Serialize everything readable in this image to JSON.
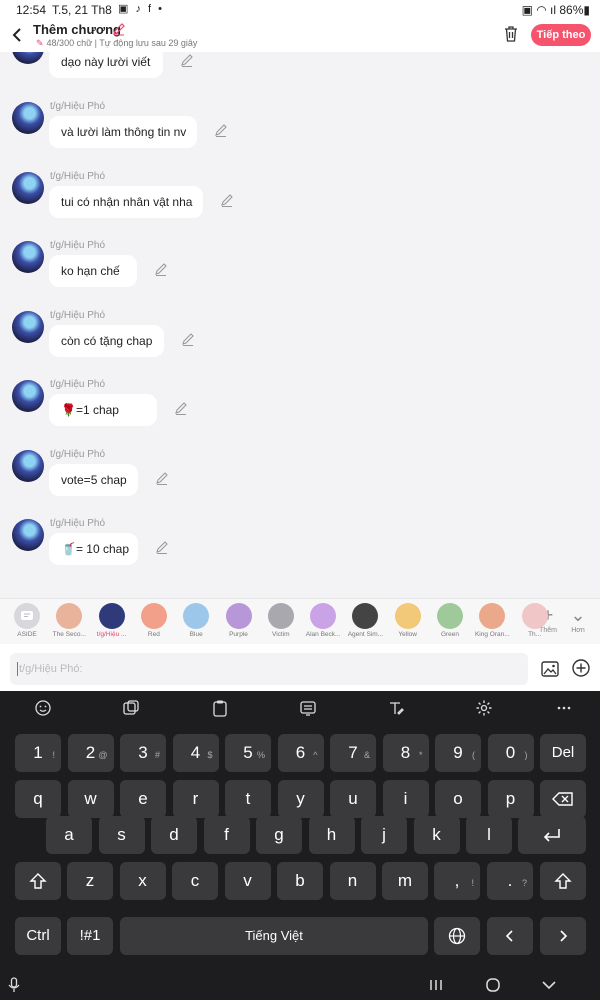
{
  "status_bar": {
    "time": "12:54",
    "date": "T.5, 21 Th8",
    "icons": "▣ ♪ f •",
    "right": "▣ ◠ ıl 86%▮"
  },
  "header": {
    "title": "Thêm chương",
    "subtitle": "48/300 chữ | Tự động lưu sau 29 giây",
    "next_label": "Tiếp theo"
  },
  "messages": [
    {
      "author": "",
      "text": "dạo này lười viết"
    },
    {
      "author": "t/g/Hiệu Phó",
      "text": "và lười làm thông tin nv"
    },
    {
      "author": "t/g/Hiệu Phó",
      "text": "tui có nhận nhân vật nha"
    },
    {
      "author": "t/g/Hiệu Phó",
      "text": "ko hạn chế"
    },
    {
      "author": "t/g/Hiệu Phó",
      "text": "còn có tặng chap"
    },
    {
      "author": "t/g/Hiệu Phó",
      "text": "🌹=1 chap"
    },
    {
      "author": "t/g/Hiệu Phó",
      "text": "vote=5 chap"
    },
    {
      "author": "t/g/Hiệu Phó",
      "text": "🥤= 10 chap"
    }
  ],
  "characters": [
    {
      "name": "ASIDE",
      "color": "#d8d8dc"
    },
    {
      "name": "The Seco...",
      "color": "#e8b39a"
    },
    {
      "name": "t/g/Hiệu ...",
      "color": "#2f3a7a",
      "selected": true
    },
    {
      "name": "Red",
      "color": "#f2a08a"
    },
    {
      "name": "Blue",
      "color": "#9cc6ea"
    },
    {
      "name": "Purple",
      "color": "#b897d8"
    },
    {
      "name": "Victim",
      "color": "#a8a8ae"
    },
    {
      "name": "Alan Beck...",
      "color": "#caa3e6"
    },
    {
      "name": "Agent Sim...",
      "color": "#444444"
    },
    {
      "name": "Yellow",
      "color": "#f2c879"
    },
    {
      "name": "Green",
      "color": "#9fc99a"
    },
    {
      "name": "King Oran...",
      "color": "#e9a98a"
    },
    {
      "name": "Th...",
      "color": "#f0c6c6"
    }
  ],
  "char_more_label": "Thêm",
  "char_hon_label": "Hơn",
  "composer": {
    "placeholder": "t/g/Hiệu Phó:"
  },
  "keyboard": {
    "row1": [
      {
        "k": "1",
        "h": "!"
      },
      {
        "k": "2",
        "h": "@"
      },
      {
        "k": "3",
        "h": "#"
      },
      {
        "k": "4",
        "h": "$"
      },
      {
        "k": "5",
        "h": "%"
      },
      {
        "k": "6",
        "h": "^"
      },
      {
        "k": "7",
        "h": "&"
      },
      {
        "k": "8",
        "h": "*"
      },
      {
        "k": "9",
        "h": "("
      },
      {
        "k": "0",
        "h": ")"
      }
    ],
    "del": "Del",
    "row2": [
      "q",
      "w",
      "e",
      "r",
      "t",
      "y",
      "u",
      "i",
      "o",
      "p"
    ],
    "row3": [
      "a",
      "s",
      "d",
      "f",
      "g",
      "h",
      "j",
      "k",
      "l"
    ],
    "row4": [
      "z",
      "x",
      "c",
      "v",
      "b",
      "n",
      "m"
    ],
    "excl": "!",
    "comma": ",",
    "question": "?",
    "period": ".",
    "ctrl": "Ctrl",
    "symbols": "!#1",
    "space": "Tiếng Việt"
  },
  "colors": {
    "accent": "#f5546c",
    "keyboard_bg": "#1d1d1f",
    "key_bg": "#3a3a3c"
  }
}
